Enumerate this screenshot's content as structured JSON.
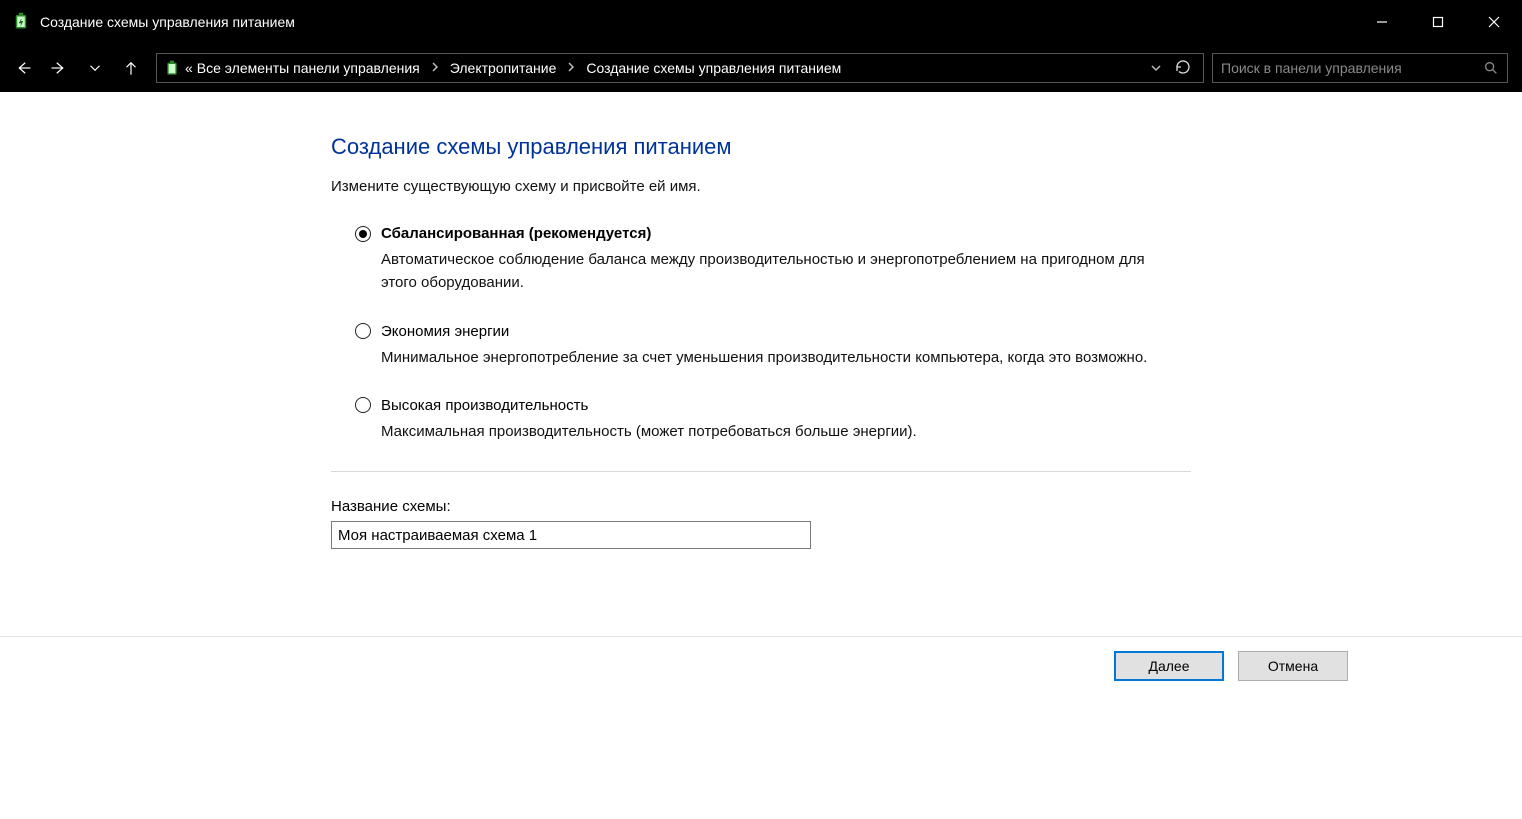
{
  "window": {
    "title": "Создание схемы управления питанием"
  },
  "breadcrumb": {
    "items": [
      "Все элементы панели управления",
      "Электропитание",
      "Создание схемы управления питанием"
    ],
    "leading_symbol": "«"
  },
  "search": {
    "placeholder": "Поиск в панели управления"
  },
  "page": {
    "title": "Создание схемы управления питанием",
    "subtitle": "Измените существующую схему и присвойте ей имя."
  },
  "plans": [
    {
      "label": "Сбалансированная (рекомендуется)",
      "description": "Автоматическое соблюдение баланса между производительностью и энергопотреблением на пригодном для этого оборудовании.",
      "selected": true
    },
    {
      "label": "Экономия энергии",
      "description": "Минимальное энергопотребление за счет уменьшения производительности компьютера, когда это возможно.",
      "selected": false
    },
    {
      "label": "Высокая производительность",
      "description": "Максимальная производительность (может потребоваться больше энергии).",
      "selected": false
    }
  ],
  "name_section": {
    "label": "Название схемы:",
    "value": "Моя настраиваемая схема 1"
  },
  "buttons": {
    "next": "Далее",
    "cancel": "Отмена"
  }
}
